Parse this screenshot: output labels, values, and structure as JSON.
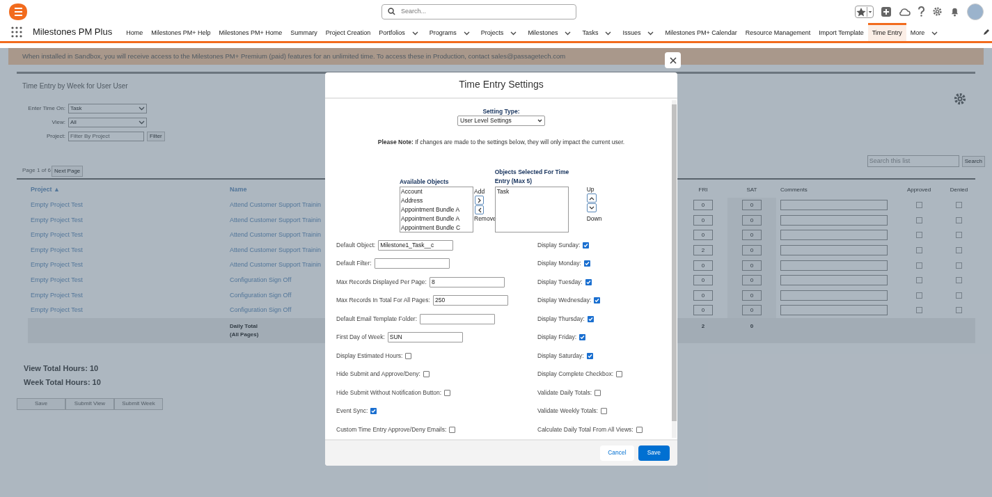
{
  "header": {
    "search_placeholder": "Search..."
  },
  "app_name": "Milestones PM Plus",
  "nav": [
    {
      "label": "Home",
      "dropdown": false,
      "selected": false
    },
    {
      "label": "Milestones PM+ Help",
      "dropdown": false,
      "selected": false
    },
    {
      "label": "Milestones PM+ Home",
      "dropdown": false,
      "selected": false
    },
    {
      "label": "Summary",
      "dropdown": false,
      "selected": false
    },
    {
      "label": "Project Creation",
      "dropdown": false,
      "selected": false
    },
    {
      "label": "Portfolios",
      "dropdown": true,
      "selected": false
    },
    {
      "label": "Programs",
      "dropdown": true,
      "selected": false
    },
    {
      "label": "Projects",
      "dropdown": true,
      "selected": false
    },
    {
      "label": "Milestones",
      "dropdown": true,
      "selected": false
    },
    {
      "label": "Tasks",
      "dropdown": true,
      "selected": false
    },
    {
      "label": "Issues",
      "dropdown": true,
      "selected": false
    },
    {
      "label": "Milestones PM+ Calendar",
      "dropdown": false,
      "selected": false
    },
    {
      "label": "Resource Management",
      "dropdown": false,
      "selected": false
    },
    {
      "label": "Import Template",
      "dropdown": false,
      "selected": false
    },
    {
      "label": "Time Entry",
      "dropdown": false,
      "selected": true
    },
    {
      "label": "More",
      "dropdown": true,
      "selected": false
    }
  ],
  "banner": "When installed in Sandbox, you will receive access to the Milestones PM+ Premium (paid) features for an unlimited time. To access these in Production, contact sales@passagetech.com",
  "page": {
    "title": "Time Entry by Week for User User",
    "filters": [
      {
        "kind": "select",
        "label": "Enter Time On:",
        "value": "Task"
      },
      {
        "kind": "select",
        "label": "View:",
        "value": "All"
      },
      {
        "kind": "text",
        "label": "Project:",
        "placeholder": "Filter By Project",
        "button": "Filter"
      }
    ],
    "pagination": {
      "text": "Page 1 of 6",
      "next": "Next Page"
    },
    "search": {
      "placeholder": "Search this list",
      "button": "Search"
    },
    "columns": {
      "project": "Project ▲",
      "name": "Name",
      "fri": "FRI",
      "sat": "SAT",
      "comments": "Comments",
      "approved": "Approved",
      "denied": "Denied"
    },
    "rows": [
      {
        "project": "Empty Project Test",
        "name": "Attend Customer Support Trainin",
        "fri": "0",
        "sat": "0",
        "approved": false,
        "denied": false
      },
      {
        "project": "Empty Project Test",
        "name": "Attend Customer Support Trainin",
        "fri": "0",
        "sat": "0",
        "approved": false,
        "denied": false
      },
      {
        "project": "Empty Project Test",
        "name": "Attend Customer Support Trainin",
        "fri": "0",
        "sat": "0",
        "approved": false,
        "denied": false
      },
      {
        "project": "Empty Project Test",
        "name": "Attend Customer Support Trainin",
        "fri": "2",
        "sat": "0",
        "approved": false,
        "denied": false
      },
      {
        "project": "Empty Project Test",
        "name": "Attend Customer Support Trainin",
        "fri": "0",
        "sat": "0",
        "approved": false,
        "denied": false
      },
      {
        "project": "Empty Project Test",
        "name": "Configuration Sign Off",
        "fri": "0",
        "sat": "0",
        "approved": false,
        "denied": false
      },
      {
        "project": "Empty Project Test",
        "name": "Configuration Sign Off",
        "fri": "0",
        "sat": "0",
        "approved": false,
        "denied": false
      },
      {
        "project": "Empty Project Test",
        "name": "Configuration Sign Off",
        "fri": "0",
        "sat": "0",
        "approved": false,
        "denied": false
      }
    ],
    "totals": {
      "label_lines": [
        "Daily Total",
        "(All Pages)"
      ],
      "fri": "2",
      "sat": "0"
    },
    "view_total": "View Total Hours: 10",
    "week_total": "Week Total Hours: 10",
    "buttons": [
      "Save",
      "Submit View",
      "Submit Week"
    ]
  },
  "modal": {
    "title": "Time Entry Settings",
    "setting_type_label": "Setting Type:",
    "setting_type_value": "User Level Settings",
    "note": "**Please Note:** If changes are made to the settings below, they will only impact the current user.",
    "available_label": "Available Objects",
    "available_items": [
      "Account",
      "Address",
      "Appointment Bundle A",
      "Appointment Bundle A",
      "Appointment Bundle C"
    ],
    "add_label": "Add",
    "remove_label": "Remove",
    "selected_label": "Objects Selected For Time Entry (Max 5)",
    "selected_items": [
      "Task"
    ],
    "up_label": "Up",
    "down_label": "Down",
    "left_fields": [
      {
        "kind": "text",
        "label": "Default Object:",
        "value": "Milestone1_Task__c"
      },
      {
        "kind": "text",
        "label": "Default Filter:"
      },
      {
        "kind": "text",
        "label": "Max Records Displayed Per Page:",
        "value": "8"
      },
      {
        "kind": "text",
        "label": "Max Records In Total For All Pages:",
        "value": "250"
      },
      {
        "kind": "text",
        "label": "Default Email Template Folder:"
      },
      {
        "kind": "text",
        "label": "First Day of Week:",
        "value": "SUN"
      },
      {
        "kind": "checkbox",
        "label": "Display Estimated Hours:",
        "checked": false
      },
      {
        "kind": "checkbox",
        "label": "Hide Submit and Approve/Deny:",
        "checked": false
      },
      {
        "kind": "checkbox",
        "label": "Hide Submit Without Notification Button:",
        "checked": false
      },
      {
        "kind": "checkbox",
        "label": "Event Sync:",
        "checked": true
      },
      {
        "kind": "checkbox",
        "label": "Custom Time Entry Approve/Deny Emails:",
        "checked": false
      }
    ],
    "right_fields": [
      {
        "kind": "checkbox",
        "label": "Display Sunday:",
        "checked": true
      },
      {
        "kind": "checkbox",
        "label": "Display Monday:",
        "checked": true
      },
      {
        "kind": "checkbox",
        "label": "Display Tuesday:",
        "checked": true
      },
      {
        "kind": "checkbox",
        "label": "Display Wednesday:",
        "checked": true
      },
      {
        "kind": "checkbox",
        "label": "Display Thursday:",
        "checked": true
      },
      {
        "kind": "checkbox",
        "label": "Display Friday:",
        "checked": true
      },
      {
        "kind": "checkbox",
        "label": "Display Saturday:",
        "checked": true
      },
      {
        "kind": "checkbox",
        "label": "Display Complete Checkbox:",
        "checked": false
      },
      {
        "kind": "checkbox",
        "label": "Validate Daily Totals:",
        "checked": false
      },
      {
        "kind": "checkbox",
        "label": "Validate Weekly Totals:",
        "checked": false
      },
      {
        "kind": "checkbox",
        "label": "Calculate Daily Total From All Views:",
        "checked": false
      }
    ],
    "cancel": "Cancel",
    "save": "Save"
  }
}
